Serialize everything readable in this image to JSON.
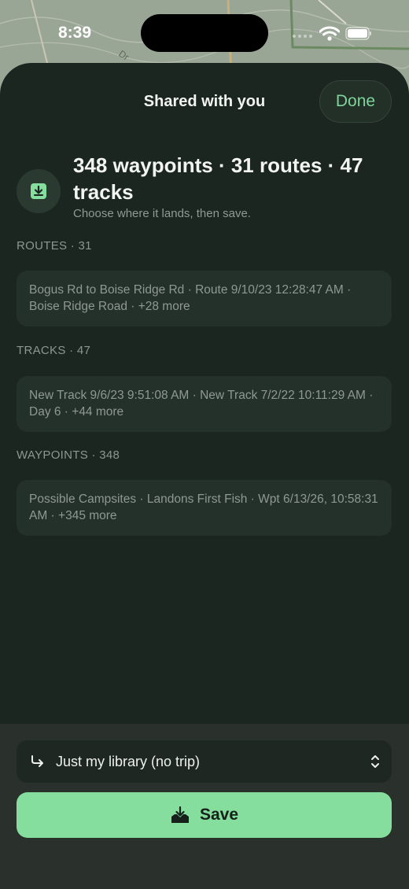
{
  "status_bar": {
    "time": "8:39"
  },
  "map": {
    "label": "Dr"
  },
  "header": {
    "title": "Shared with you",
    "done_label": "Done"
  },
  "summary": {
    "headline": "348 waypoints · 31 routes · 47 tracks",
    "subtitle": "Choose where it lands, then save."
  },
  "sections": [
    {
      "label": "ROUTES · 31",
      "summary": "Bogus Rd to Boise Ridge Rd · Route 9/10/23 12:28:47 AM · Boise Ridge Road · +28 more"
    },
    {
      "label": "TRACKS · 47",
      "summary": "New Track 9/6/23 9:51:08 AM · New Track 7/2/22 10:11:29 AM · Day 6 · +44 more"
    },
    {
      "label": "WAYPOINTS · 348",
      "summary": "Possible Campsites · Landons First Fish · Wpt 6/13/26, 10:58:31 AM · +345 more"
    }
  ],
  "footer": {
    "destination_label": "Just my library (no trip)",
    "save_label": "Save"
  },
  "colors": {
    "accent": "#7ed49a",
    "save_button": "#86de9e",
    "sheet": "#1c2620"
  },
  "icons": {
    "import": "download-tray-icon",
    "destination": "arrow-turn-right-icon",
    "chevron": "chevron-up-down-icon",
    "save": "tray-download-icon",
    "wifi": "wifi-icon",
    "battery": "battery-icon"
  }
}
